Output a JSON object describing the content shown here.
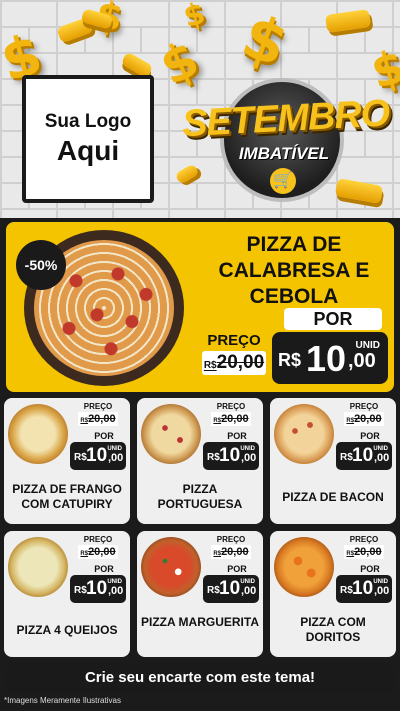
{
  "logo": {
    "line1": "Sua Logo",
    "line2": "Aqui"
  },
  "badge": {
    "title": "SETEMBRO",
    "subtitle": "IMBATÍVEL",
    "icon": "cart-icon"
  },
  "featured": {
    "discount": "-50%",
    "name": "PIZZA DE CALABRESA E CEBOLA",
    "por_label": "POR",
    "preco_label": "PREÇO",
    "old_currency": "R$",
    "old_price": "20,00",
    "currency": "R$",
    "price_int": "10",
    "price_dec": ",00",
    "unit": "UNID"
  },
  "products": [
    {
      "name": "PIZZA DE FRANGO COM CATUPIRY",
      "preco_label": "PREÇO",
      "old_currency": "R$",
      "old_price": "20,00",
      "por_label": "POR",
      "currency": "R$",
      "price_int": "10",
      "price_dec": ",00",
      "unit": "UNID"
    },
    {
      "name": "PIZZA PORTUGUESA",
      "preco_label": "PREÇO",
      "old_currency": "R$",
      "old_price": "20,00",
      "por_label": "POR",
      "currency": "R$",
      "price_int": "10",
      "price_dec": ",00",
      "unit": "UNID"
    },
    {
      "name": "PIZZA DE BACON",
      "preco_label": "PREÇO",
      "old_currency": "R$",
      "old_price": "20,00",
      "por_label": "POR",
      "currency": "R$",
      "price_int": "10",
      "price_dec": ",00",
      "unit": "UNID"
    },
    {
      "name": "PIZZA 4 QUEIJOS",
      "preco_label": "PREÇO",
      "old_currency": "R$",
      "old_price": "20,00",
      "por_label": "POR",
      "currency": "R$",
      "price_int": "10",
      "price_dec": ",00",
      "unit": "UNID"
    },
    {
      "name": "PIZZA MARGUERITA",
      "preco_label": "PREÇO",
      "old_currency": "R$",
      "old_price": "20,00",
      "por_label": "POR",
      "currency": "R$",
      "price_int": "10",
      "price_dec": ",00",
      "unit": "UNID"
    },
    {
      "name": "PIZZA COM DORITOS",
      "preco_label": "PREÇO",
      "old_currency": "R$",
      "old_price": "20,00",
      "por_label": "POR",
      "currency": "R$",
      "price_int": "10",
      "price_dec": ",00",
      "unit": "UNID"
    }
  ],
  "cta": "Crie seu encarte com este tema!",
  "footnote": "*Imagens Meramente Ilustrativas",
  "colors": {
    "accent": "#f5c400",
    "dark": "#1a1a1a"
  }
}
